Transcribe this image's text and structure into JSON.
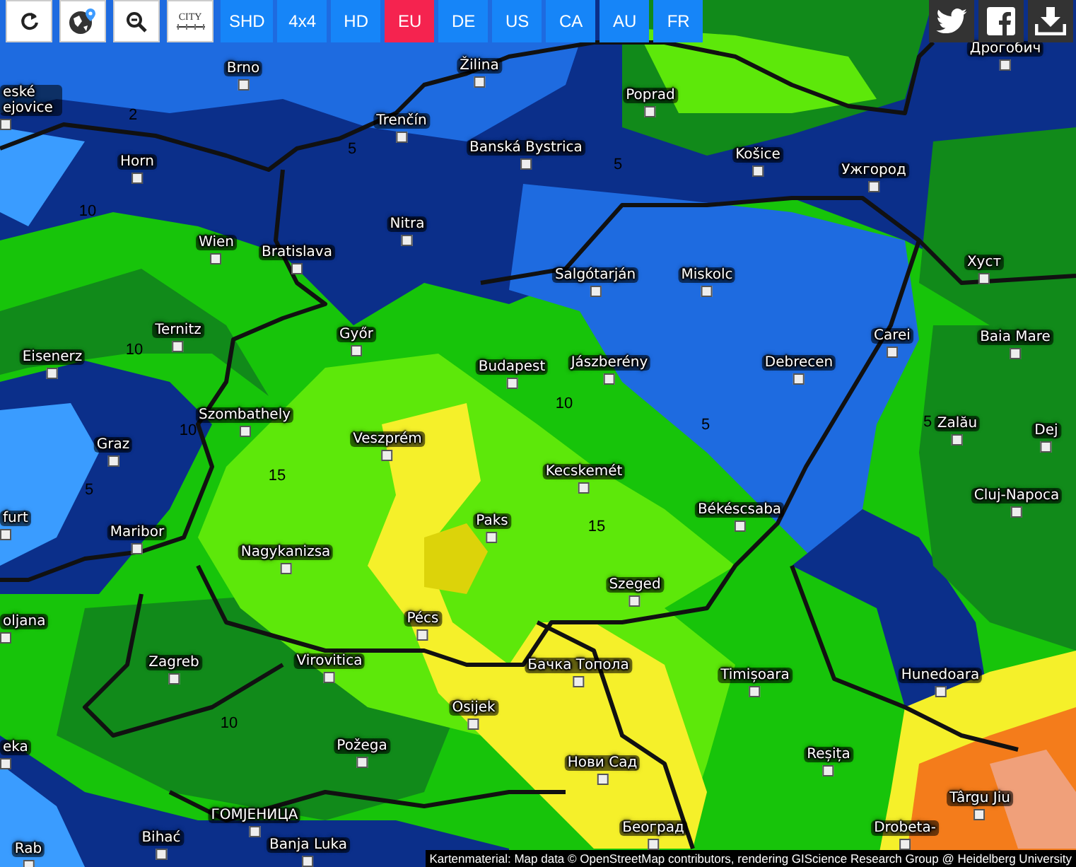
{
  "toolbar": {
    "tools": [
      {
        "kind": "refresh"
      },
      {
        "kind": "globe"
      },
      {
        "kind": "zoom"
      },
      {
        "kind": "city",
        "label": "CITY"
      }
    ],
    "regions": [
      {
        "label": "SHD",
        "selected": false
      },
      {
        "label": "4x4",
        "selected": false
      },
      {
        "label": "HD",
        "selected": false
      },
      {
        "label": "EU",
        "selected": true
      },
      {
        "label": "DE",
        "selected": false
      },
      {
        "label": "US",
        "selected": false
      },
      {
        "label": "CA",
        "selected": false
      },
      {
        "label": "AU",
        "selected": false
      },
      {
        "label": "FR",
        "selected": false
      }
    ],
    "share": [
      {
        "kind": "twitter"
      },
      {
        "kind": "facebook"
      },
      {
        "kind": "download"
      }
    ]
  },
  "map": {
    "cities": [
      {
        "name": "Brno"
      },
      {
        "name": "Žilina"
      },
      {
        "name": "Poprad"
      },
      {
        "name": "Дрогобич"
      },
      {
        "name": "eské ejovice"
      },
      {
        "name": "Trenčín"
      },
      {
        "name": "Banská Bystrica"
      },
      {
        "name": "Košice"
      },
      {
        "name": "Ужгород"
      },
      {
        "name": "Horn"
      },
      {
        "name": "Wien"
      },
      {
        "name": "Bratislava"
      },
      {
        "name": "Nitra"
      },
      {
        "name": "Salgótarján"
      },
      {
        "name": "Miskolc"
      },
      {
        "name": "Хуст"
      },
      {
        "name": "Ternitz"
      },
      {
        "name": "Győr"
      },
      {
        "name": "Budapest"
      },
      {
        "name": "Jászberény"
      },
      {
        "name": "Debrecen"
      },
      {
        "name": "Carei"
      },
      {
        "name": "Baia Mare"
      },
      {
        "name": "Eisenerz"
      },
      {
        "name": "Szombathely"
      },
      {
        "name": "Veszprém"
      },
      {
        "name": "Zalău"
      },
      {
        "name": "Dej"
      },
      {
        "name": "Graz"
      },
      {
        "name": "Kecskemét"
      },
      {
        "name": "Cluj-Napoca"
      },
      {
        "name": "Békéscsaba"
      },
      {
        "name": "furt"
      },
      {
        "name": "Maribor"
      },
      {
        "name": "Paks"
      },
      {
        "name": "Nagykanizsa"
      },
      {
        "name": "Szeged"
      },
      {
        "name": "oljana"
      },
      {
        "name": "Pécs"
      },
      {
        "name": "Virovitica"
      },
      {
        "name": "Бачка Топола"
      },
      {
        "name": "Timișoara"
      },
      {
        "name": "Hunedoara"
      },
      {
        "name": "Zagreb"
      },
      {
        "name": "Osijek"
      },
      {
        "name": "eka"
      },
      {
        "name": "Požega"
      },
      {
        "name": "Reșița"
      },
      {
        "name": "Нови Сад"
      },
      {
        "name": "Târgu Jiu"
      },
      {
        "name": "ГОМЈЕНИЦА"
      },
      {
        "name": "Bihać"
      },
      {
        "name": "Rab"
      },
      {
        "name": "Banja Luka"
      },
      {
        "name": "Београд"
      },
      {
        "name": "Drobeta-"
      }
    ],
    "contour_labels": [
      "2",
      "5",
      "10",
      "5",
      "10",
      "10",
      "15",
      "5",
      "10",
      "5",
      "5",
      "15",
      "10"
    ]
  },
  "attribution": "Kartenmaterial: Map data © OpenStreetMap contributors, rendering GIScience Research Group @ Heidelberg University"
}
